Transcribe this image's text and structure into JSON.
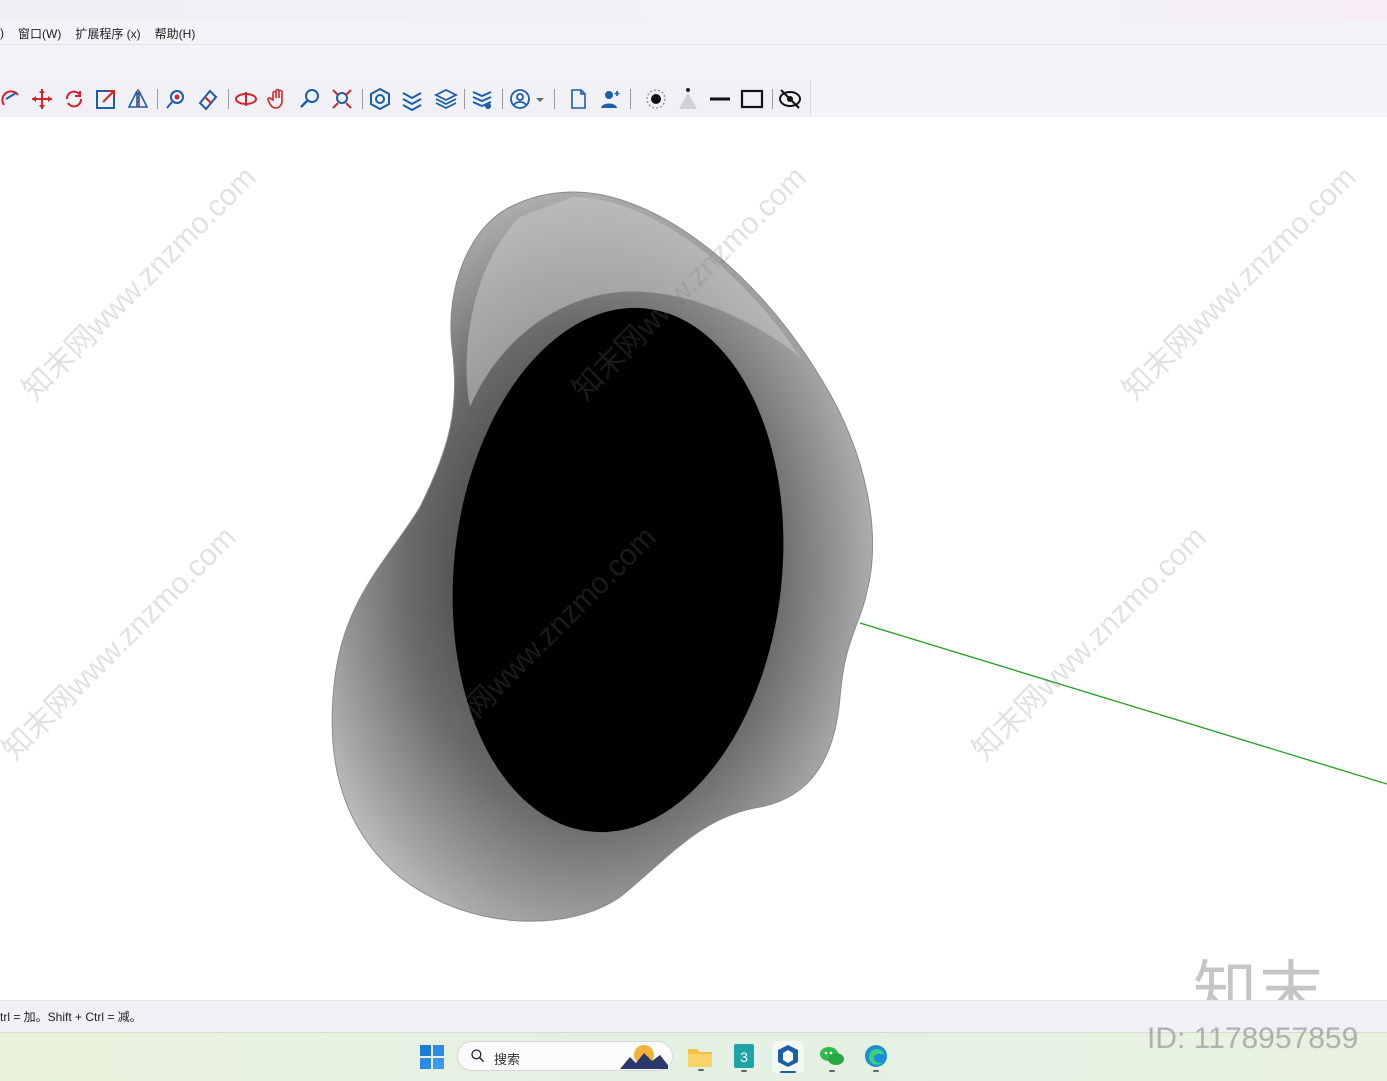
{
  "menu": {
    "partial_item": ")",
    "items": [
      "窗口(W)",
      "扩展程序 (x)",
      "帮助(H)"
    ]
  },
  "toolbar": {
    "icons": [
      "follow-me-icon",
      "move-icon",
      "rotate-icon",
      "scale-icon",
      "flip-icon",
      "paint-bucket-icon",
      "eraser-icon",
      "position-camera-icon",
      "pan-hand-icon",
      "zoom-icon",
      "zoom-extents-icon",
      "solid-tools-icon",
      "sandbox-icon",
      "layers-icon",
      "styles-icon",
      "user-account-icon",
      "new-document-icon",
      "add-user-icon",
      "shadow-toggle-icon",
      "fog-icon",
      "line-style-icon",
      "rectangle-icon",
      "hide-icon"
    ]
  },
  "status": {
    "text": "trl = 加。Shift + Ctrl = 减。"
  },
  "taskbar": {
    "search_placeholder": "搜索",
    "apps": [
      "windows-start-icon",
      "file-explorer-icon",
      "3dsmax-icon",
      "sketchup-icon",
      "wechat-icon",
      "edge-icon"
    ]
  },
  "watermark": {
    "text": "知末网www.znzmo.com",
    "brand": "知末",
    "id": "ID: 1178957859"
  },
  "colors": {
    "accent_red": "#d0262c",
    "accent_blue": "#1a5fa8",
    "axis_green": "#22a022"
  }
}
